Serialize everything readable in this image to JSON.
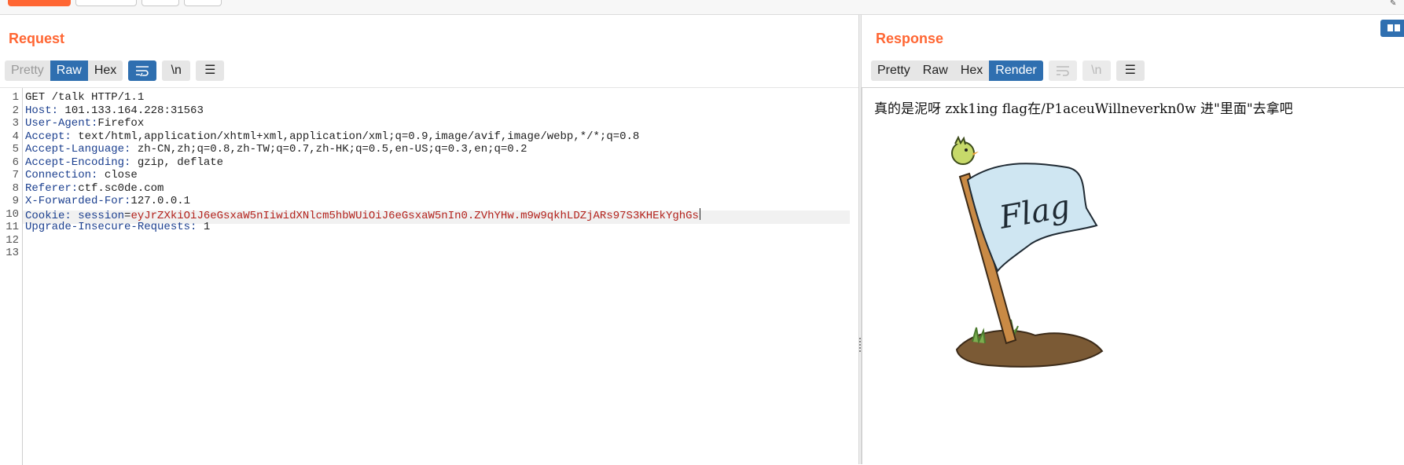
{
  "request": {
    "title": "Request",
    "tabs": [
      "Pretty",
      "Raw",
      "Hex"
    ],
    "active_tab": "Raw",
    "icons": {
      "wrap": "wrap-lines-icon",
      "newline": "\\n",
      "menu": "menu-icon"
    },
    "lines": [
      {
        "n": "1",
        "key": "",
        "sep": "",
        "val": "GET /talk HTTP/1.1"
      },
      {
        "n": "2",
        "key": "Host:",
        "sep": " ",
        "val": "101.133.164.228:31563"
      },
      {
        "n": "3",
        "key": "User-Agent:",
        "sep": "",
        "val": "Firefox"
      },
      {
        "n": "4",
        "key": "Accept:",
        "sep": " ",
        "val": "text/html,application/xhtml+xml,application/xml;q=0.9,image/avif,image/webp,*/*;q=0.8"
      },
      {
        "n": "5",
        "key": "Accept-Language:",
        "sep": " ",
        "val": "zh-CN,zh;q=0.8,zh-TW;q=0.7,zh-HK;q=0.5,en-US;q=0.3,en;q=0.2"
      },
      {
        "n": "6",
        "key": "Accept-Encoding:",
        "sep": " ",
        "val": "gzip, deflate"
      },
      {
        "n": "7",
        "key": "Connection:",
        "sep": " ",
        "val": "close"
      },
      {
        "n": "8",
        "key": "Referer:",
        "sep": "",
        "val": "ctf.sc0de.com"
      },
      {
        "n": "9",
        "key": "X-Forwarded-For:",
        "sep": "",
        "val": "127.0.0.1"
      },
      {
        "n": "10",
        "key": "Cookie: session",
        "sep": "=",
        "val": "eyJrZXkiOiJ6eGsxaW5nIiwidXNlcm5hbWUiOiJ6eGsxaW5nIn0.ZVhYHw.m9w9qkhLDZjARs97S3KHEkYghGs"
      },
      {
        "n": "11",
        "key": "Upgrade-Insecure-Requests:",
        "sep": " ",
        "val": "1"
      },
      {
        "n": "12",
        "key": "",
        "sep": "",
        "val": ""
      },
      {
        "n": "13",
        "key": "",
        "sep": "",
        "val": ""
      }
    ]
  },
  "response": {
    "title": "Response",
    "tabs": [
      "Pretty",
      "Raw",
      "Hex",
      "Render"
    ],
    "active_tab": "Render",
    "rendered_text": "真的是泥呀 zxk1ing flag在/P1aceuWillneverkn0w 进\"里面\"去拿吧",
    "image_text": "Flag"
  },
  "colors": {
    "accent": "#ff6633",
    "active_tab": "#2f6fb0",
    "header_key": "#1b3f8f",
    "cookie_value": "#b3221c"
  }
}
